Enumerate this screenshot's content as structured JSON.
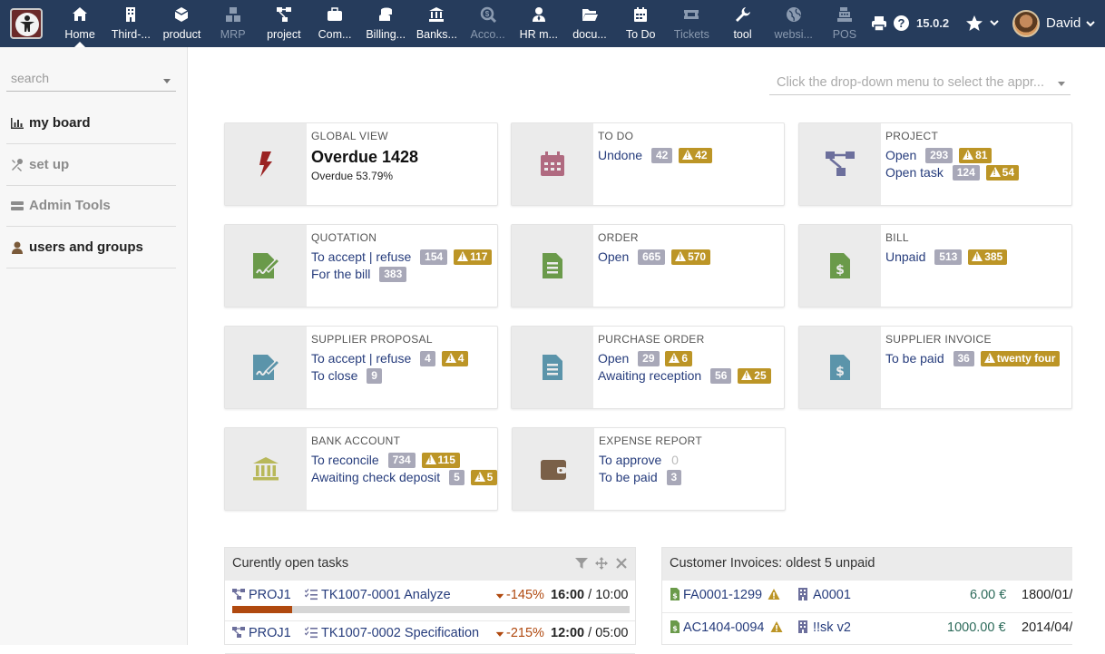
{
  "topbar": {
    "menu": [
      {
        "label": "Home",
        "icon": "home-icon",
        "active": true,
        "disabled": false
      },
      {
        "label": "Third-...",
        "icon": "building-icon",
        "active": false,
        "disabled": false
      },
      {
        "label": "product",
        "icon": "cube-icon",
        "active": false,
        "disabled": false
      },
      {
        "label": "MRP",
        "icon": "cubes-icon",
        "active": false,
        "disabled": true
      },
      {
        "label": "project",
        "icon": "sitemap-icon",
        "active": false,
        "disabled": false
      },
      {
        "label": "Com...",
        "icon": "suitcase-icon",
        "active": false,
        "disabled": false
      },
      {
        "label": "Billing...",
        "icon": "coins-icon",
        "active": false,
        "disabled": false
      },
      {
        "label": "Banks...",
        "icon": "bank-icon",
        "active": false,
        "disabled": false
      },
      {
        "label": "Acco...",
        "icon": "search-dollar-icon",
        "active": false,
        "disabled": true
      },
      {
        "label": "HR m...",
        "icon": "user-tie-icon",
        "active": false,
        "disabled": false
      },
      {
        "label": "docu...",
        "icon": "folder-open-icon",
        "active": false,
        "disabled": false
      },
      {
        "label": "To Do",
        "icon": "calendar-icon",
        "active": false,
        "disabled": false
      },
      {
        "label": "Tickets",
        "icon": "ticket-icon",
        "active": false,
        "disabled": true
      },
      {
        "label": "tool",
        "icon": "wrench-icon",
        "active": false,
        "disabled": false
      },
      {
        "label": "websi...",
        "icon": "globe-icon",
        "active": false,
        "disabled": true
      },
      {
        "label": "POS",
        "icon": "cash-register-icon",
        "active": false,
        "disabled": true
      }
    ],
    "version": "15.0.2",
    "help": "?",
    "user_name": "David"
  },
  "sidebar": {
    "search_placeholder": "search",
    "items": [
      {
        "label": "my board",
        "style": "strong",
        "icon": "bar-chart-icon"
      },
      {
        "label": "set up",
        "style": "muted",
        "icon": "tools-icon"
      },
      {
        "label": "Admin Tools",
        "style": "muted",
        "icon": "server-icon"
      },
      {
        "label": "users and groups",
        "style": "strong",
        "icon": "user-icon"
      }
    ]
  },
  "filter_placeholder": "Click the drop-down menu to select the appr...",
  "boxes": {
    "global": {
      "title": "GLOBAL VIEW",
      "big": "Overdue 1428",
      "small": "Overdue 53.79%"
    },
    "todo": {
      "title": "TO DO",
      "lines": [
        {
          "label": "Undone",
          "count": "42",
          "warn": "42"
        }
      ]
    },
    "project": {
      "title": "PROJECT",
      "lines": [
        {
          "label": "Open",
          "count": "293",
          "warn": "81"
        },
        {
          "label": "Open task",
          "count": "124",
          "warn": "54"
        }
      ]
    },
    "quotation": {
      "title": "QUOTATION",
      "lines": [
        {
          "label": "To accept | refuse",
          "count": "154",
          "warn": "117"
        },
        {
          "label": "For the bill",
          "count": "383"
        }
      ]
    },
    "order": {
      "title": "ORDER",
      "lines": [
        {
          "label": "Open",
          "count": "665",
          "warn": "570"
        }
      ]
    },
    "bill": {
      "title": "BILL",
      "lines": [
        {
          "label": "Unpaid",
          "count": "513",
          "warn": "385"
        }
      ]
    },
    "supplier_proposal": {
      "title": "SUPPLIER PROPOSAL",
      "lines": [
        {
          "label": "To accept | refuse",
          "count": "4",
          "warn": "4"
        },
        {
          "label": "To close",
          "count": "9"
        }
      ]
    },
    "purchase_order": {
      "title": "PURCHASE ORDER",
      "lines": [
        {
          "label": "Open",
          "count": "29",
          "warn": "6"
        },
        {
          "label": "Awaiting reception",
          "count": "56",
          "warn": "25"
        }
      ]
    },
    "supplier_invoice": {
      "title": "SUPPLIER INVOICE",
      "lines": [
        {
          "label": "To be paid",
          "count": "36",
          "warn": "twenty four"
        }
      ]
    },
    "bank_account": {
      "title": "BANK ACCOUNT",
      "lines": [
        {
          "label": "To reconcile",
          "count": "734",
          "warn": "115"
        },
        {
          "label": "Awaiting check deposit",
          "count": "5",
          "warn": "5"
        }
      ]
    },
    "expense_report": {
      "title": "EXPENSE REPORT",
      "lines": [
        {
          "label": "To approve",
          "zero": "0"
        },
        {
          "label": "To be paid",
          "count": "3"
        }
      ]
    }
  },
  "tasks_panel": {
    "title": "Curently open tasks",
    "rows": [
      {
        "project": "PROJ1",
        "task": "TK1007-0001 Analyze",
        "pct": "-145%",
        "spent": "16:00",
        "planned": "10:00",
        "progress": 0.15
      },
      {
        "project": "PROJ1",
        "task": "TK1007-0002 Specification",
        "pct": "-215%",
        "spent": "12:00",
        "planned": "05:00",
        "progress": 0
      }
    ]
  },
  "invoices_panel": {
    "title": "Customer Invoices: oldest 5 unpaid",
    "rows": [
      {
        "ref": "FA0001-1299",
        "customer": "A0001",
        "amount": "6.00 €",
        "date": "1800/01/"
      },
      {
        "ref": "AC1404-0094",
        "customer": "!!sk v2",
        "amount": "1000.00 €",
        "date": "2014/04/"
      }
    ]
  },
  "colors": {
    "topbar": "#263c5c",
    "link": "#263c7c",
    "badge": "#a8a8b8",
    "warning": "#bc9526",
    "progress": "#b0490f"
  }
}
